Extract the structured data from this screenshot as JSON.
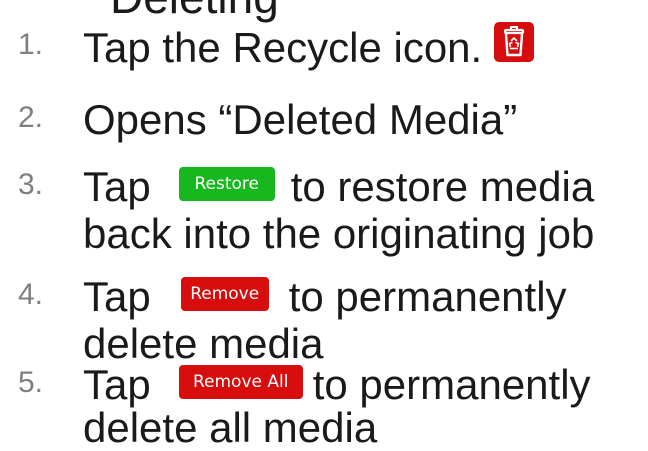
{
  "heading": {
    "partial_text": "Deleting"
  },
  "steps": [
    {
      "number": "1.",
      "lines": [
        "Tap the Recycle icon."
      ],
      "icon": "recycle-trash-icon"
    },
    {
      "number": "2.",
      "lines": [
        "Opens “Deleted Media”"
      ]
    },
    {
      "number": "3.",
      "before": "Tap",
      "button": "Restore",
      "after": "to restore media",
      "line2": "back into the originating job"
    },
    {
      "number": "4.",
      "before": "Tap",
      "button": "Remove",
      "after": "to permanently",
      "line2": "delete media"
    },
    {
      "number": "5.",
      "before": "Tap",
      "button": "Remove All",
      "after": "to permanently",
      "line2": "delete all media"
    }
  ],
  "colors": {
    "restore_button": "#17b81d",
    "remove_button": "#d70c0c",
    "recycle_icon_bg": "#d70c0c",
    "number_text": "#7f7f7f",
    "body_text": "#1a1a1a"
  }
}
